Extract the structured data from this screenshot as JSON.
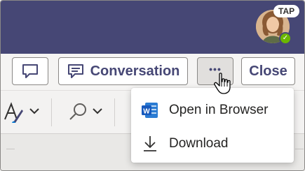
{
  "header": {
    "badge": "TAP",
    "colors": {
      "header_bg": "#464775",
      "presence": "#6bb700"
    }
  },
  "toolbar": {
    "comment_icon": "comment-icon",
    "conversation_label": "Conversation",
    "more_label": "•••",
    "close_label": "Close",
    "accent": "#464775"
  },
  "ribbon": {
    "icons": [
      "font-style-icon",
      "chevron-down-icon",
      "search-icon",
      "chevron-down-icon"
    ]
  },
  "menu": {
    "items": [
      {
        "label": "Open in Browser",
        "icon": "word-icon"
      },
      {
        "label": "Download",
        "icon": "download-icon"
      }
    ],
    "word_color": "#185abd"
  }
}
